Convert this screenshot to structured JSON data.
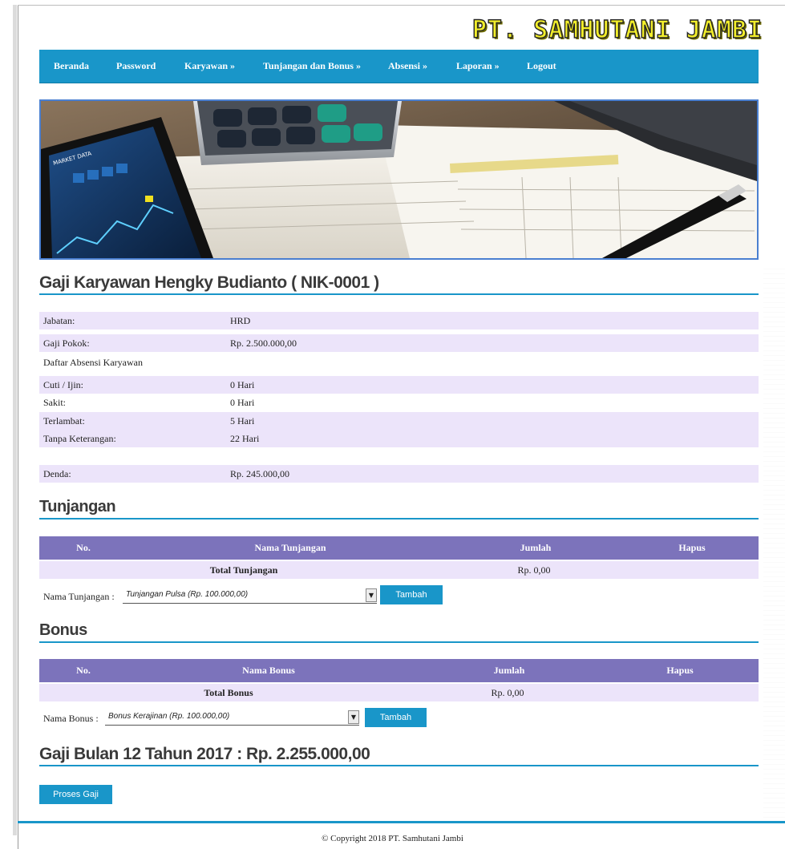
{
  "brand": {
    "title": "PT. SAMHUTANI JAMBI"
  },
  "nav": [
    {
      "label": "Beranda"
    },
    {
      "label": "Password"
    },
    {
      "label": "Karyawan »"
    },
    {
      "label": "Tunjangan dan Bonus »"
    },
    {
      "label": "Absensi »"
    },
    {
      "label": "Laporan »"
    },
    {
      "label": "Logout"
    }
  ],
  "banner": {
    "screen_text": "MARKET DATA"
  },
  "page_title": "Gaji Karyawan Hengky Budianto ( NIK-0001 )",
  "info": [
    {
      "label": "Jabatan:",
      "value": "HRD"
    },
    {
      "label": "Gaji Pokok:",
      "value": "Rp. 2.500.000,00"
    },
    {
      "label": "Daftar Absensi Karyawan",
      "value": ""
    },
    {
      "label": "Cuti / Ijin:",
      "value": "0 Hari"
    },
    {
      "label": "Sakit:",
      "value": "0 Hari"
    },
    {
      "label": "Terlambat:",
      "value": "5 Hari"
    },
    {
      "label": "Tanpa Keterangan:",
      "value": "22 Hari"
    },
    {
      "label": "Denda:",
      "value": "Rp. 245.000,00"
    }
  ],
  "tunjangan": {
    "heading": "Tunjangan",
    "columns": [
      "No.",
      "Nama Tunjangan",
      "Jumlah",
      "Hapus"
    ],
    "total_label": "Total Tunjangan",
    "total_value": "Rp. 0,00",
    "form_label": "Nama Tunjangan :",
    "selected": "Tunjangan Pulsa (Rp. 100.000,00)",
    "button": "Tambah"
  },
  "bonus": {
    "heading": "Bonus",
    "columns": [
      "No.",
      "Nama Bonus",
      "Jumlah",
      "Hapus"
    ],
    "total_label": "Total Bonus",
    "total_value": "Rp. 0,00",
    "form_label": "Nama Bonus :",
    "selected": "Bonus Kerajinan (Rp. 100.000,00)",
    "button": "Tambah"
  },
  "salary_title": "Gaji Bulan 12 Tahun 2017 : Rp. 2.255.000,00",
  "process_button": "Proses Gaji",
  "footer": "© Copyright 2018 PT. Samhutani Jambi"
}
